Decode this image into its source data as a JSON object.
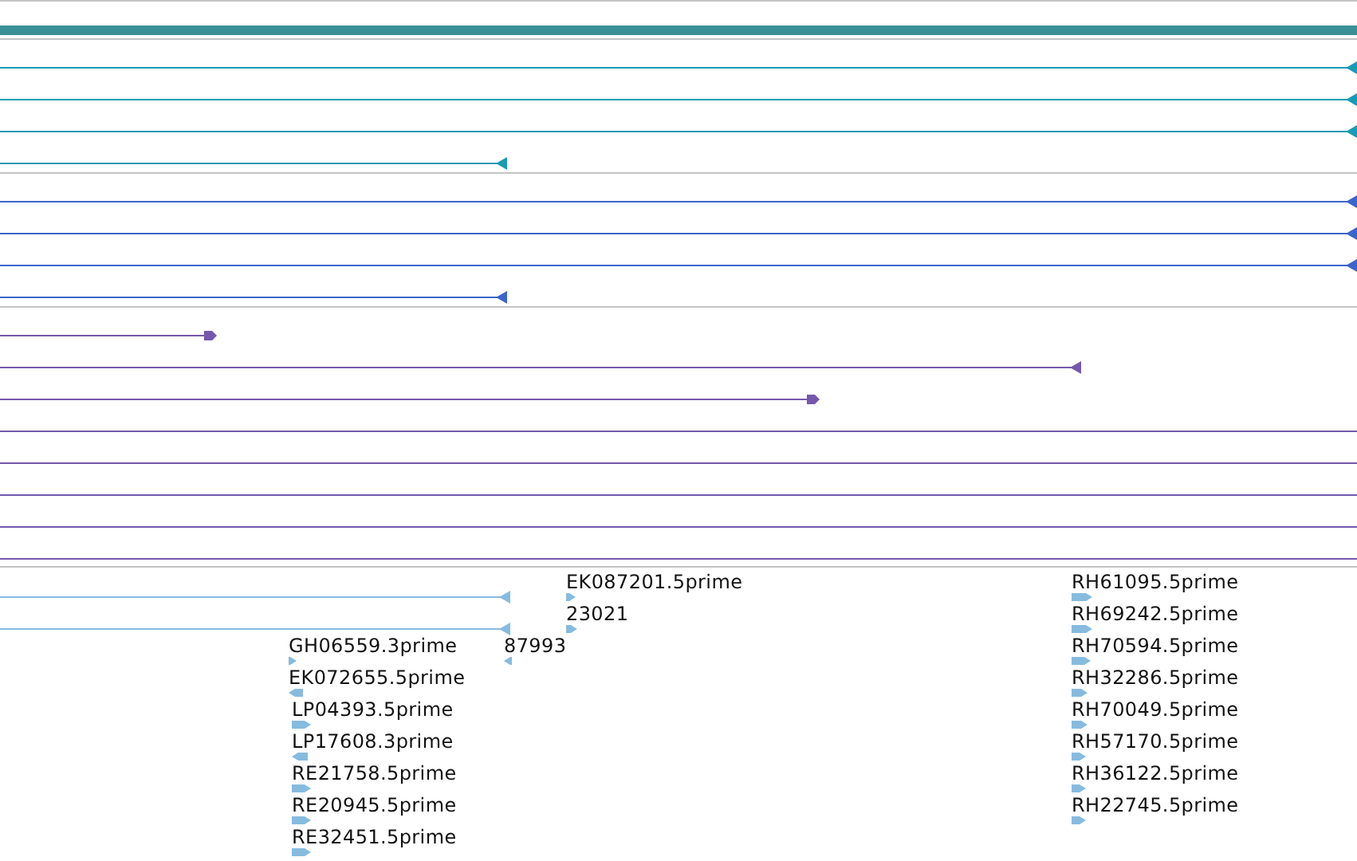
{
  "tracks": [
    {
      "color": "#3a8f96",
      "features": [
        {
          "kind": "bar"
        }
      ]
    },
    {
      "color": "#1a9bb5",
      "features": [
        {
          "kind": "line",
          "reverse": true
        },
        {
          "kind": "line",
          "reverse": true
        },
        {
          "kind": "line",
          "reverse": true
        },
        {
          "kind": "line",
          "reverse": true
        }
      ]
    },
    {
      "color": "#3a66c8",
      "features": [
        {
          "kind": "line",
          "reverse": true
        },
        {
          "kind": "line",
          "reverse": true
        },
        {
          "kind": "line",
          "reverse": true
        },
        {
          "kind": "line",
          "reverse": true
        }
      ]
    },
    {
      "color": "#7558ad",
      "features": [
        {
          "kind": "line",
          "reverse": false
        },
        {
          "kind": "line",
          "reverse": true
        },
        {
          "kind": "line",
          "reverse": false
        },
        {
          "kind": "rule"
        },
        {
          "kind": "rule"
        },
        {
          "kind": "rule"
        },
        {
          "kind": "rule"
        },
        {
          "kind": "rule"
        }
      ]
    },
    {
      "color": "#86bbdf",
      "features": [
        {
          "kind": "line",
          "reverse": true
        },
        {
          "kind": "line",
          "reverse": true
        },
        {
          "kind": "glyph",
          "reverse": false,
          "label": "EK087201.5prime"
        },
        {
          "kind": "glyph",
          "reverse": false,
          "label": "23021"
        },
        {
          "kind": "glyph",
          "reverse": false,
          "label": "GH06559.3prime"
        },
        {
          "kind": "glyph",
          "reverse": true,
          "label": "87993"
        },
        {
          "kind": "glyph",
          "reverse": true,
          "label": "EK072655.5prime"
        },
        {
          "kind": "glyph",
          "reverse": false,
          "label": "LP04393.5prime"
        },
        {
          "kind": "glyph",
          "reverse": true,
          "label": "LP17608.3prime"
        },
        {
          "kind": "glyph",
          "reverse": false,
          "label": "RE21758.5prime"
        },
        {
          "kind": "glyph",
          "reverse": false,
          "label": "RE20945.5prime"
        },
        {
          "kind": "glyph",
          "reverse": false,
          "label": "RE32451.5prime"
        },
        {
          "kind": "glyph",
          "reverse": false,
          "label": "RH61095.5prime"
        },
        {
          "kind": "glyph",
          "reverse": false,
          "label": "RH69242.5prime"
        },
        {
          "kind": "glyph",
          "reverse": false,
          "label": "RH70594.5prime"
        },
        {
          "kind": "glyph",
          "reverse": false,
          "label": "RH32286.5prime"
        },
        {
          "kind": "glyph",
          "reverse": false,
          "label": "RH70049.5prime"
        },
        {
          "kind": "glyph",
          "reverse": false,
          "label": "RH57170.5prime"
        },
        {
          "kind": "glyph",
          "reverse": false,
          "label": "RH36122.5prime"
        },
        {
          "kind": "glyph",
          "reverse": false,
          "label": "RH22745.5prime"
        }
      ]
    }
  ]
}
